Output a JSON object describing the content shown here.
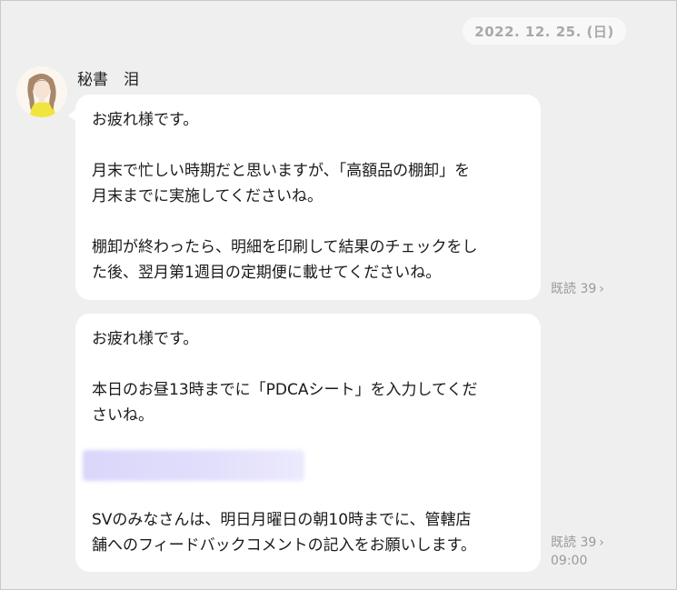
{
  "date_separator": "2022. 12. 25. (日)",
  "sender": {
    "name": "秘書　泪"
  },
  "messages": [
    {
      "lines": [
        "お疲れ様です。",
        "",
        "月末で忙しい時期だと思いますが、「高額品の棚卸」を",
        "月末までに実施してくださいね。",
        "",
        "棚卸が終わったら、明細を印刷して結果のチェックをし",
        "た後、翌月第1週目の定期便に載せてくださいね。"
      ],
      "read_label": "既読 39",
      "read_chevron": "›"
    },
    {
      "top_lines": [
        "お疲れ様です。",
        "",
        "本日のお昼13時までに「PDCAシート」を入力してくだ",
        "さいね。"
      ],
      "bottom_lines": [
        "SVのみなさんは、明日月曜日の朝10時までに、管轄店",
        "舗へのフィードバックコメントの記入をお願いします。"
      ],
      "read_label": "既読 39",
      "read_chevron": "›",
      "time": "09:00"
    }
  ],
  "colors": {
    "chat_background": "#efefef",
    "bubble": "#ffffff",
    "meta_text": "#9a9a9a",
    "blurred_link": "#dcd9fb"
  }
}
